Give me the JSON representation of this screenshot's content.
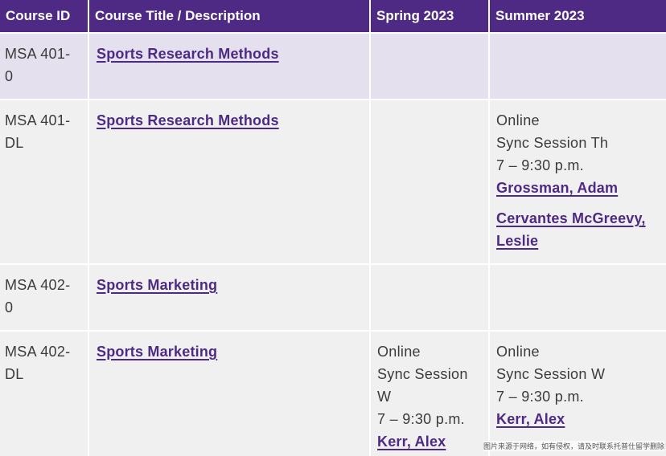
{
  "table": {
    "headers": {
      "id": "Course ID",
      "title": "Course Title / Description",
      "spring": "Spring 2023",
      "summer": "Summer 2023"
    },
    "rows": [
      {
        "id_line1": "MSA 401-",
        "id_line2": "0",
        "title": "Sports Research Methods"
      },
      {
        "id_line1": "MSA 401-",
        "id_line2": "DL",
        "title": "Sports Research Methods",
        "summer": {
          "mode": "Online",
          "session": "Sync Session Th",
          "time": "7 – 9:30 p.m.",
          "instructor1": "Grossman, Adam",
          "instructor2_line1": "Cervantes McGreevy,",
          "instructor2_line2": "Leslie"
        }
      },
      {
        "id_line1": "MSA 402-",
        "id_line2": "0",
        "title": "Sports Marketing"
      },
      {
        "id_line1": "MSA 402-",
        "id_line2": "DL",
        "title": "Sports Marketing",
        "spring": {
          "mode": "Online",
          "session_line1": "Sync Session",
          "session_line2": "W",
          "time": "7 – 9:30 p.m.",
          "instructor": "Kerr, Alex"
        },
        "summer": {
          "mode": "Online",
          "session": "Sync Session W",
          "time": "7 – 9:30 p.m.",
          "instructor": "Kerr, Alex"
        }
      }
    ]
  },
  "watermark": "图片来源于网络，如有侵权，请及时联系托普仕留学删除",
  "colors": {
    "header_bg": "#4e2a84",
    "row_a_bg": "#e4e0ee",
    "row_b_bg": "#f0f0f0",
    "link": "#4e2a84"
  }
}
